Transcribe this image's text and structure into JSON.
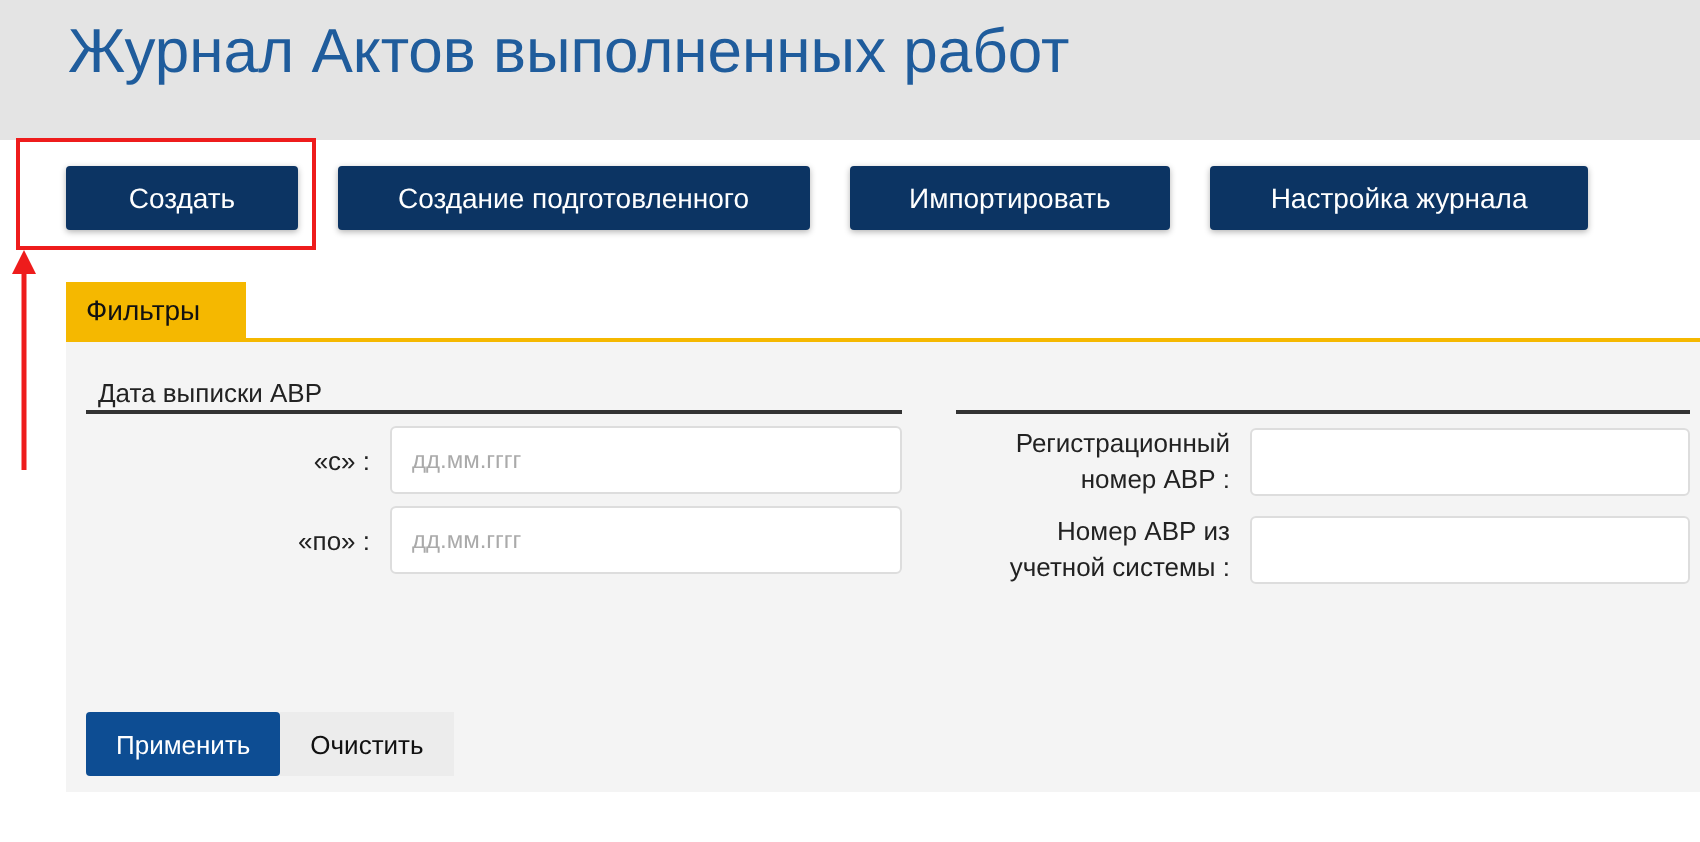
{
  "header": {
    "title": "Журнал Актов выполненных работ"
  },
  "actions": [
    {
      "label": "Создать",
      "highlighted": true
    },
    {
      "label": "Создание подготовленного",
      "highlighted": false
    },
    {
      "label": "Импортировать",
      "highlighted": false
    },
    {
      "label": "Настройка журнала",
      "highlighted": false
    }
  ],
  "filters": {
    "tab": "Фильтры",
    "date_section": {
      "title": "Дата выписки АВР",
      "fields": [
        {
          "label": "«с» :",
          "placeholder": "дд.мм.гггг"
        },
        {
          "label": "«по» :",
          "placeholder": "дд.мм.гггг"
        }
      ]
    },
    "right_fields": [
      {
        "label": "Регистрационный номер АВР :"
      },
      {
        "label": "Номер АВР из учетной системы :"
      }
    ],
    "buttons": [
      {
        "label": "Применить",
        "kind": "primary"
      },
      {
        "label": "Очистить",
        "kind": "secondary"
      }
    ]
  }
}
